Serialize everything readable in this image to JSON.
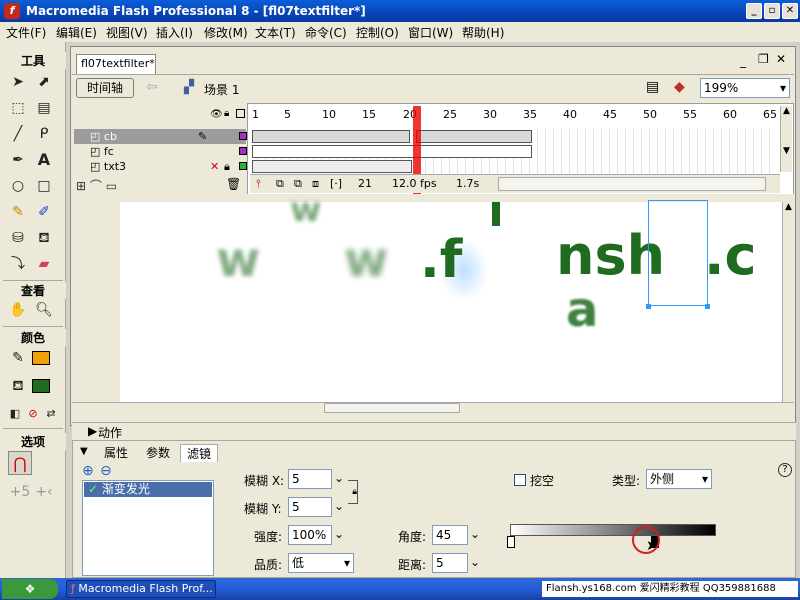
{
  "window": {
    "title": "Macromedia Flash Professional 8 - [fl07textfilter*]",
    "min": "_",
    "restore": "▫",
    "close": "✕"
  },
  "menus": [
    "文件(F)",
    "编辑(E)",
    "视图(V)",
    "插入(I)",
    "修改(M)",
    "文本(T)",
    "命令(C)",
    "控制(O)",
    "窗口(W)",
    "帮助(H)"
  ],
  "tools": {
    "title": "工具",
    "view_title": "查看",
    "color_title": "颜色",
    "options_title": "选项"
  },
  "doc": {
    "tab": "fl07textfilter*",
    "timeline_btn": "时间轴",
    "scene": "场景 1",
    "zoom": "199%"
  },
  "timeline": {
    "frame_numbers": [
      "1",
      "5",
      "10",
      "15",
      "20",
      "25",
      "30",
      "35",
      "40",
      "45",
      "50",
      "55",
      "60",
      "65"
    ],
    "layers": [
      {
        "name": "cb",
        "color": "#a030c0"
      },
      {
        "name": "fc",
        "color": "#a030c0"
      },
      {
        "name": "txt3",
        "color": "#30b030"
      }
    ],
    "current_frame": "21",
    "fps": "12.0 fps",
    "time": "1.7s"
  },
  "stage": {
    "chars": [
      "w",
      "w",
      "w",
      ".f",
      "i",
      "nsh",
      "h",
      ".c",
      "a"
    ]
  },
  "panels": {
    "actions": "动作",
    "tabs": [
      "属性",
      "参数",
      "滤镜"
    ],
    "filter_item": "渐变发光",
    "blur_x_label": "模糊 X:",
    "blur_x": "5",
    "blur_y_label": "模糊 Y:",
    "blur_y": "5",
    "strength_label": "强度:",
    "strength": "100%",
    "quality_label": "品质:",
    "quality": "低",
    "knockout_label": "挖空",
    "type_label": "类型:",
    "type": "外侧",
    "angle_label": "角度:",
    "angle": "45",
    "distance_label": "距离:",
    "distance": "5"
  },
  "taskbar": {
    "start": "",
    "task": "Macromedia Flash Prof...",
    "tray": "Flansh.ys168.com 爱闪精彩教程 QQ359881688"
  },
  "colors": {
    "titlebar": "#0a5fd8",
    "text_green": "#1f6b1f",
    "stroke_swatch": "#f0a000",
    "fill_swatch": "#1f6b1f"
  }
}
